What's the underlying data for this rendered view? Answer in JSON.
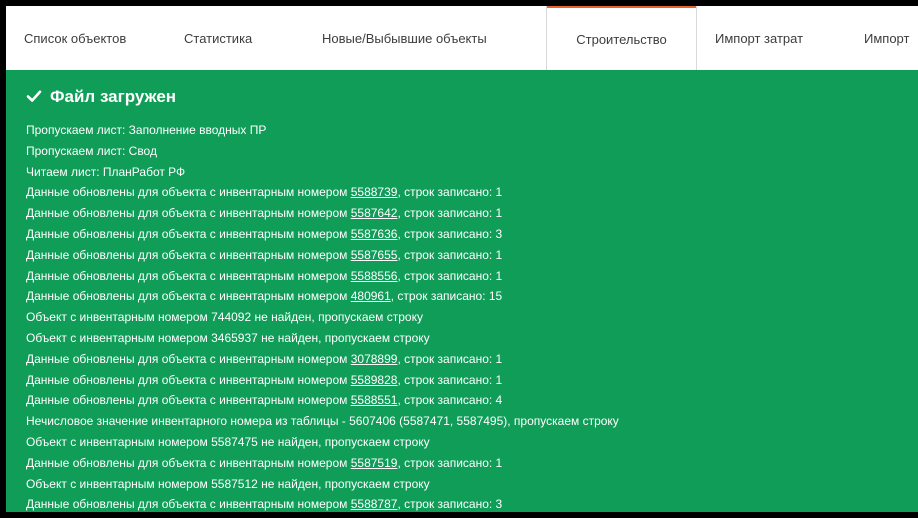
{
  "tabs": [
    {
      "label": "Список объектов",
      "active": false
    },
    {
      "label": "Статистика",
      "active": false
    },
    {
      "label": "Новые/Выбывшие объекты",
      "active": false
    },
    {
      "label": "Строительство",
      "active": true
    },
    {
      "label": "Импорт затрат",
      "active": false
    },
    {
      "label": "Импорт",
      "active": false
    }
  ],
  "colors": {
    "panel_background": "#0f9d58",
    "active_tab_accent": "#e8622a"
  },
  "status": {
    "icon": "check-icon",
    "title": "Файл загружен"
  },
  "log": [
    {
      "text": "Пропускаем лист: Заполнение вводных ПР"
    },
    {
      "text": "Пропускаем лист: Свод"
    },
    {
      "text": "Читаем лист: ПланРабот РФ"
    },
    {
      "pre": "Данные обновлены для объекта с инвентарным номером ",
      "link": "5588739",
      "post": ", строк записано: 1"
    },
    {
      "pre": "Данные обновлены для объекта с инвентарным номером ",
      "link": "5587642",
      "post": ", строк записано: 1"
    },
    {
      "pre": "Данные обновлены для объекта с инвентарным номером ",
      "link": "5587636",
      "post": ", строк записано: 3"
    },
    {
      "pre": "Данные обновлены для объекта с инвентарным номером ",
      "link": "5587655",
      "post": ", строк записано: 1"
    },
    {
      "pre": "Данные обновлены для объекта с инвентарным номером ",
      "link": "5588556",
      "post": ", строк записано: 1"
    },
    {
      "pre": "Данные обновлены для объекта с инвентарным номером ",
      "link": "480961",
      "post": ", строк записано: 15"
    },
    {
      "text": "Объект с инвентарным номером 744092 не найден, пропускаем строку"
    },
    {
      "text": "Объект с инвентарным номером 3465937 не найден, пропускаем строку"
    },
    {
      "pre": "Данные обновлены для объекта с инвентарным номером ",
      "link": "3078899",
      "post": ", строк записано: 1"
    },
    {
      "pre": "Данные обновлены для объекта с инвентарным номером ",
      "link": "5589828",
      "post": ", строк записано: 1"
    },
    {
      "pre": "Данные обновлены для объекта с инвентарным номером ",
      "link": "5588551",
      "post": ", строк записано: 4"
    },
    {
      "text": "Нечисловое значение инвентарного номера из таблицы - 5607406 (5587471, 5587495), пропускаем строку"
    },
    {
      "text": "Объект с инвентарным номером 5587475 не найден, пропускаем строку"
    },
    {
      "pre": "Данные обновлены для объекта с инвентарным номером ",
      "link": "5587519",
      "post": ", строк записано: 1"
    },
    {
      "text": "Объект с инвентарным номером 5587512 не найден, пропускаем строку"
    },
    {
      "pre": "Данные обновлены для объекта с инвентарным номером ",
      "link": "5588787",
      "post": ", строк записано: 3"
    }
  ]
}
